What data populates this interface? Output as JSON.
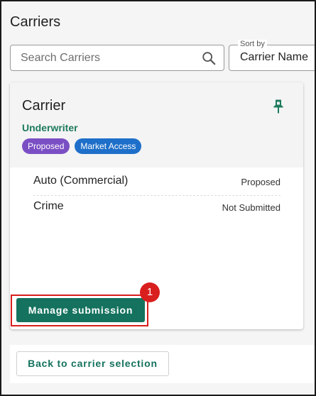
{
  "page": {
    "title": "Carriers"
  },
  "search": {
    "placeholder": "Search Carriers",
    "value": "",
    "icon": "search-icon"
  },
  "sort": {
    "label": "Sort by",
    "value": "Carrier Name"
  },
  "carrier_card": {
    "title": "Carrier",
    "subtitle": "Underwriter",
    "pin_icon": "pin-icon",
    "chips": [
      {
        "label": "Proposed",
        "color": "#7b4fc4"
      },
      {
        "label": "Market Access",
        "color": "#1e6fc9"
      }
    ],
    "lines": [
      {
        "name": "Auto (Commercial)",
        "status": "Proposed"
      },
      {
        "name": "Crime",
        "status": "Not Submitted"
      }
    ],
    "manage_button": "Manage submission"
  },
  "annotation": {
    "step": "1",
    "color": "#d91e1e"
  },
  "footer": {
    "back_button": "Back to carrier selection"
  },
  "colors": {
    "accent": "#14725e",
    "subtitle": "#1e7a5e"
  }
}
